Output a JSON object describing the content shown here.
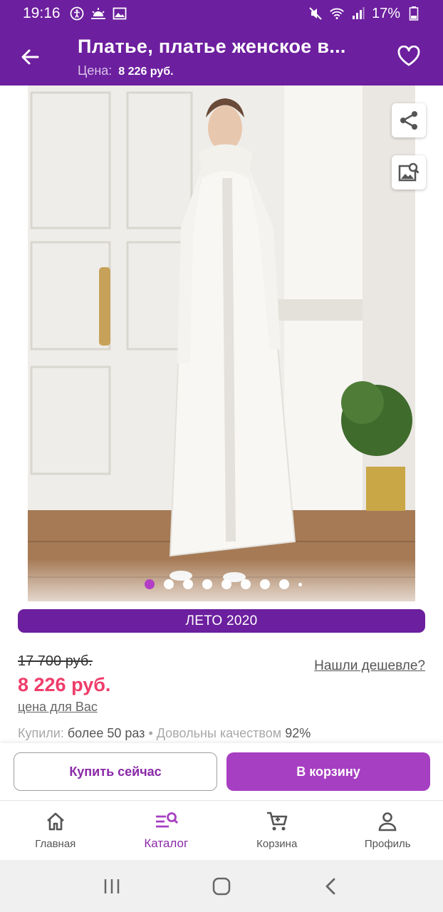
{
  "status_bar": {
    "time": "19:16",
    "battery": "17%"
  },
  "header": {
    "title": "Платье, платье женское в...",
    "price_label": "Цена:",
    "price_value": "8 226 руб."
  },
  "gallery": {
    "page_count": 9,
    "active_index": 0
  },
  "promo": {
    "label": "ЛЕТО 2020"
  },
  "pricing": {
    "old_price": "17 700 руб.",
    "new_price": "8 226 руб.",
    "cheaper_link": "Нашли дешевле?",
    "your_price_link": "цена для Вас"
  },
  "stats": {
    "bought_label": "Купили:",
    "bought_value": "более 50 раз",
    "separator": "•",
    "quality_label": "Довольны качеством",
    "quality_value": "92%"
  },
  "actions": {
    "buy_now": "Купить сейчас",
    "add_to_cart": "В корзину"
  },
  "bottom_nav": {
    "items": [
      {
        "label": "Главная",
        "icon": "home-icon"
      },
      {
        "label": "Каталог",
        "icon": "catalog-search-icon"
      },
      {
        "label": "Корзина",
        "icon": "cart-icon"
      },
      {
        "label": "Профиль",
        "icon": "profile-icon"
      }
    ],
    "active": 1
  },
  "colors": {
    "brand_purple": "#6c1f9e",
    "accent_purple": "#a73fc2",
    "price_pink": "#ef3d6a"
  }
}
